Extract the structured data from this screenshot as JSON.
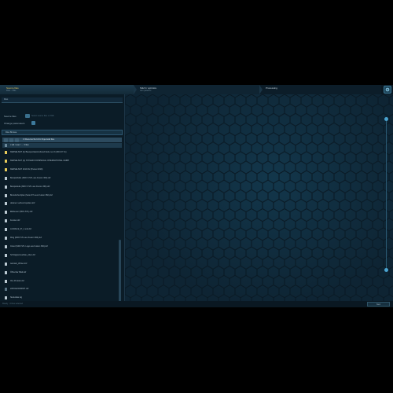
{
  "steps": [
    {
      "title": "Source files",
      "sub": "Files - XML"
    },
    {
      "title": "Stitch / optimize",
      "sub": "Join patterns"
    },
    {
      "title": "Processing",
      "sub": ""
    }
  ],
  "tab": {
    "label": "Files"
  },
  "source": {
    "label": "Source files",
    "value": "Select source files or XML",
    "change_label": "Change parameters"
  },
  "file_header": {
    "label": "Files Browse"
  },
  "toolbar": {
    "path": "C:\\Benutzer\\hk-fc\\01 Objects\\all files"
  },
  "current_path": {
    "label": "c:/all / user / ... / Files"
  },
  "files": [
    {
      "name": "KERSELSCH (b) Bauspezialeinzelbeschriebe res 6 (2019 07 11)",
      "kind": "folder"
    },
    {
      "name": "KERSELSCH (A) STÜLER FOOSPECIAL INTERNATIONAL GMBH",
      "kind": "folder"
    },
    {
      "name": "KERSELSCH 2019 AV (Preisel 2019)",
      "kind": "folder"
    },
    {
      "name": "Beispielhafte (NDO 3 STL aus Fusion 360).dxf",
      "kind": "file"
    },
    {
      "name": "Beispielteile (NDO 3 STL aus Fusion 360).dxf",
      "kind": "file"
    },
    {
      "name": "Brandschutzplan (Seite STL aus Fusion 360).dxf",
      "kind": "file"
    },
    {
      "name": "dowiner verbund spalten.dxf",
      "kind": "file"
    },
    {
      "name": "ElEAusen (NDO-STL).dxf",
      "kind": "file"
    },
    {
      "name": "Fenster.dxf",
      "kind": "file"
    },
    {
      "name": "LichtWerk_07_1 und.dxf",
      "kind": "file"
    },
    {
      "name": "Ring (NDO STL aus Fusion 360).dxf",
      "kind": "file"
    },
    {
      "name": "Cloud (NDO STL Logo aus Fusion 360).dxf",
      "kind": "file"
    },
    {
      "name": "Schrägpanneelbau_oben.dxf",
      "kind": "file"
    },
    {
      "name": "tutorials_Winter.dxf",
      "kind": "file"
    },
    {
      "name": "Öffnerbar Blatt.dxf",
      "kind": "file"
    },
    {
      "name": "Ihre Produkt.dxf",
      "kind": "file"
    },
    {
      "name": "22031124030937.dxf",
      "kind": "dim"
    },
    {
      "name": "Stufenklar.xlg",
      "kind": "file"
    }
  ],
  "footer": {
    "status": "Ready · 0 files selected",
    "next_label": "Next"
  },
  "colors": {
    "accent": "#e0c15a",
    "hex_bg": "#0e2433",
    "slider": "#4aa3cf"
  },
  "zoom_slider": {
    "top_value": 1.0,
    "bottom_value": 0.0
  }
}
